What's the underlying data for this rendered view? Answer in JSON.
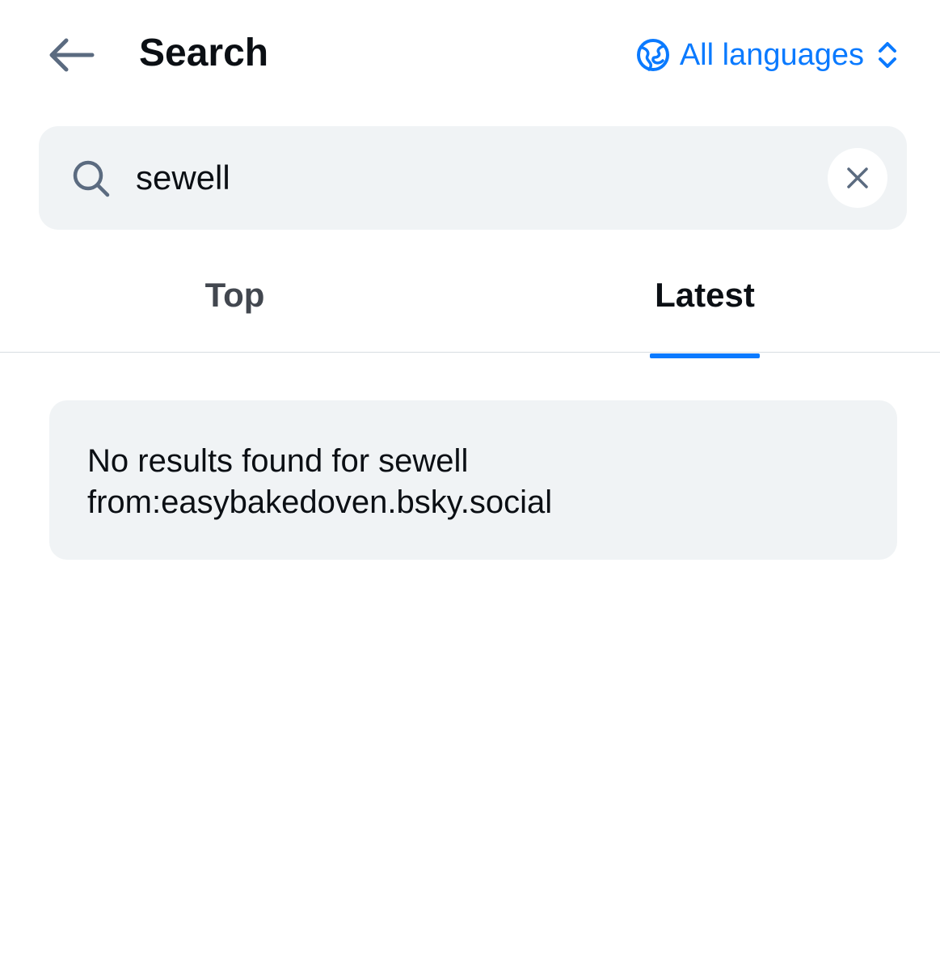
{
  "header": {
    "back_icon": "arrow-left-icon",
    "title": "Search",
    "language_icon": "globe-icon",
    "language_label": "All languages",
    "language_chevron_icon": "chevron-up-down-icon"
  },
  "search": {
    "icon": "search-icon",
    "value": "sewell",
    "clear_icon": "close-icon"
  },
  "tabs": [
    {
      "label": "Top",
      "active": false
    },
    {
      "label": "Latest",
      "active": true
    }
  ],
  "results": {
    "empty_message": "No results found for sewell from:easybakedoven.bsky.social"
  },
  "colors": {
    "accent": "#0a7aff",
    "surface": "#f0f3f5",
    "text": "#0b0f14",
    "muted_text": "#42474f",
    "icon": "#5b6b80"
  }
}
